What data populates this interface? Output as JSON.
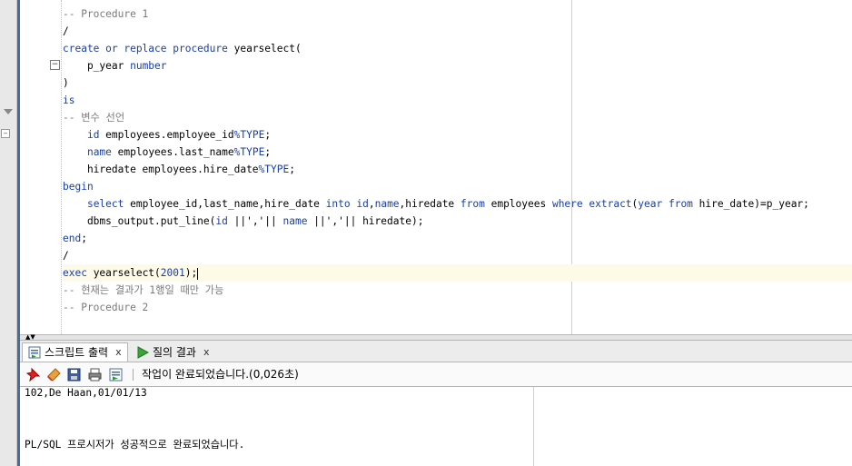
{
  "editor": {
    "code_lines": [
      {
        "parts": [
          {
            "t": "",
            "c": ""
          }
        ]
      },
      {
        "parts": [
          {
            "t": "-- Procedure 1",
            "c": "cm"
          }
        ]
      },
      {
        "parts": [
          {
            "t": "/",
            "c": ""
          }
        ]
      },
      {
        "parts": [
          {
            "t": "create or replace procedure ",
            "c": "kw"
          },
          {
            "t": "yearselect(",
            "c": ""
          }
        ]
      },
      {
        "parts": [
          {
            "t": "    p_year ",
            "c": ""
          },
          {
            "t": "number",
            "c": "kw"
          }
        ]
      },
      {
        "parts": [
          {
            "t": ")",
            "c": ""
          }
        ]
      },
      {
        "parts": [
          {
            "t": "is",
            "c": "kw"
          }
        ]
      },
      {
        "parts": [
          {
            "t": "-- 변수 선언",
            "c": "cm"
          }
        ]
      },
      {
        "parts": [
          {
            "t": "    ",
            "c": ""
          },
          {
            "t": "id",
            "c": "kw"
          },
          {
            "t": " employees.employee_id",
            "c": ""
          },
          {
            "t": "%TYPE",
            "c": "kw"
          },
          {
            "t": ";",
            "c": ""
          }
        ]
      },
      {
        "parts": [
          {
            "t": "    ",
            "c": ""
          },
          {
            "t": "name",
            "c": "kw"
          },
          {
            "t": " employees.last_name",
            "c": ""
          },
          {
            "t": "%TYPE",
            "c": "kw"
          },
          {
            "t": ";",
            "c": ""
          }
        ]
      },
      {
        "parts": [
          {
            "t": "    hiredate employees.hire_date",
            "c": ""
          },
          {
            "t": "%TYPE",
            "c": "kw"
          },
          {
            "t": ";",
            "c": ""
          }
        ]
      },
      {
        "parts": [
          {
            "t": "begin",
            "c": "kw"
          }
        ]
      },
      {
        "parts": [
          {
            "t": "    ",
            "c": ""
          },
          {
            "t": "select",
            "c": "kw"
          },
          {
            "t": " employee_id,last_name,hire_date ",
            "c": ""
          },
          {
            "t": "into",
            "c": "kw"
          },
          {
            "t": " ",
            "c": ""
          },
          {
            "t": "id",
            "c": "kw"
          },
          {
            "t": ",",
            "c": ""
          },
          {
            "t": "name",
            "c": "kw"
          },
          {
            "t": ",hiredate ",
            "c": ""
          },
          {
            "t": "from",
            "c": "kw"
          },
          {
            "t": " employees ",
            "c": ""
          },
          {
            "t": "where",
            "c": "kw"
          },
          {
            "t": " ",
            "c": ""
          },
          {
            "t": "extract",
            "c": "kw"
          },
          {
            "t": "(",
            "c": ""
          },
          {
            "t": "year from",
            "c": "kw"
          },
          {
            "t": " hire_date)=p_year;",
            "c": ""
          }
        ]
      },
      {
        "parts": [
          {
            "t": "    dbms_output.put_line(",
            "c": ""
          },
          {
            "t": "id",
            "c": "kw"
          },
          {
            "t": " ||','|| ",
            "c": ""
          },
          {
            "t": "name",
            "c": "kw"
          },
          {
            "t": " ||','|| hiredate);",
            "c": ""
          }
        ]
      },
      {
        "parts": [
          {
            "t": "end",
            "c": "kw"
          },
          {
            "t": ";",
            "c": ""
          }
        ]
      },
      {
        "parts": [
          {
            "t": "/",
            "c": ""
          }
        ]
      },
      {
        "parts": [
          {
            "t": "exec",
            "c": "kw"
          },
          {
            "t": " yearselect(",
            "c": ""
          },
          {
            "t": "2001",
            "c": "num"
          },
          {
            "t": ");",
            "c": ""
          }
        ],
        "current": true
      },
      {
        "parts": [
          {
            "t": "-- 현재는 결과가 1행일 때만 가능",
            "c": "cm"
          }
        ]
      },
      {
        "parts": [
          {
            "t": "-- Procedure 2",
            "c": "cm"
          }
        ]
      }
    ]
  },
  "panel": {
    "tabs": [
      {
        "label": "스크립트 출력",
        "close": "x",
        "icon": "script-output-icon"
      },
      {
        "label": "질의 결과",
        "close": "x",
        "icon": "run-query-icon"
      }
    ],
    "status": "작업이 완료되었습니다.(0,026초)",
    "output_lines": [
      "102,De Haan,01/01/13",
      "PL/SQL 프로시저가 성공적으로 완료되었습니다."
    ]
  },
  "colors": {
    "keyword": "#1a3ea6",
    "comment": "#7a7a7a",
    "current_line": "#fdfbe8",
    "accent": "#4a6c9b"
  }
}
